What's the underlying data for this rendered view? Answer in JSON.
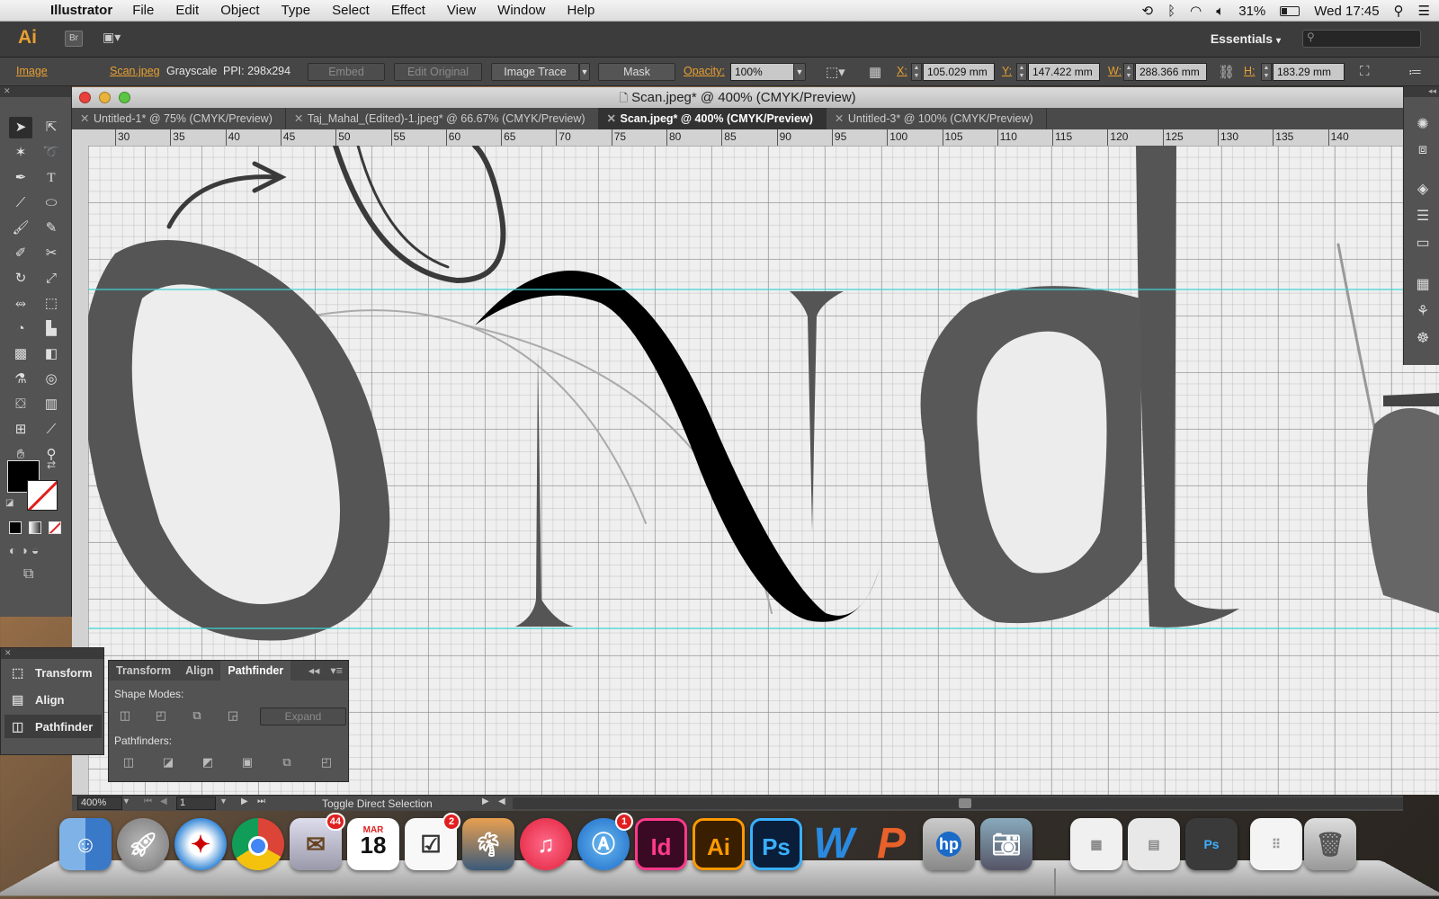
{
  "menubar": {
    "app": "Illustrator",
    "items": [
      "File",
      "Edit",
      "Object",
      "Type",
      "Select",
      "Effect",
      "View",
      "Window",
      "Help"
    ],
    "battery": "31%",
    "clock": "Wed 17:45"
  },
  "appbar": {
    "logo": "Ai",
    "br": "Br",
    "workspace": "Essentials",
    "workspace_arrow": "▾"
  },
  "control": {
    "kind": "Image",
    "file": "Scan.jpeg",
    "mode": "Grayscale",
    "ppi": "PPI: 298x294",
    "embed": "Embed",
    "edit_original": "Edit Original",
    "image_trace": "Image Trace",
    "mask": "Mask",
    "opacity_label": "Opacity:",
    "opacity": "100%",
    "x_label": "X:",
    "x": "105.029 mm",
    "y_label": "Y:",
    "y": "147.422 mm",
    "w_label": "W:",
    "w": "288.366 mm",
    "h_label": "H:",
    "h": "183.29 mm"
  },
  "doc": {
    "title": "Scan.jpeg* @ 400% (CMYK/Preview)"
  },
  "tabs": [
    {
      "label": "Untitled-1* @ 75% (CMYK/Preview)"
    },
    {
      "label": "Taj_Mahal_(Edited)-1.jpeg* @ 66.67% (CMYK/Preview)"
    },
    {
      "label": "Scan.jpeg* @ 400% (CMYK/Preview)"
    },
    {
      "label": "Untitled-3* @ 100% (CMYK/Preview)"
    }
  ],
  "ruler": [
    "30",
    "35",
    "40",
    "45",
    "50",
    "55",
    "60",
    "65",
    "70",
    "75",
    "80",
    "85",
    "90",
    "95",
    "100",
    "105",
    "110",
    "115",
    "120",
    "125",
    "130",
    "135",
    "140"
  ],
  "mini_panel": {
    "items": [
      "Transform",
      "Align",
      "Pathfinder"
    ]
  },
  "pathfinder": {
    "tabs": [
      "Transform",
      "Align",
      "Pathfinder"
    ],
    "shape_modes": "Shape Modes:",
    "expand": "Expand",
    "pathfinders": "Pathfinders:"
  },
  "status": {
    "zoom": "400%",
    "page": "1",
    "message": "Toggle Direct Selection"
  },
  "dock": {
    "mail_badge": "44",
    "reminders_badge": "2",
    "appstore_badge": "1",
    "calendar_month": "MAR",
    "calendar_day": "18",
    "indesign": "Id",
    "illustrator": "Ai",
    "photoshop": "Ps",
    "word": "W",
    "powerpoint": "P",
    "hp": "hp",
    "ps_small": "Ps"
  }
}
